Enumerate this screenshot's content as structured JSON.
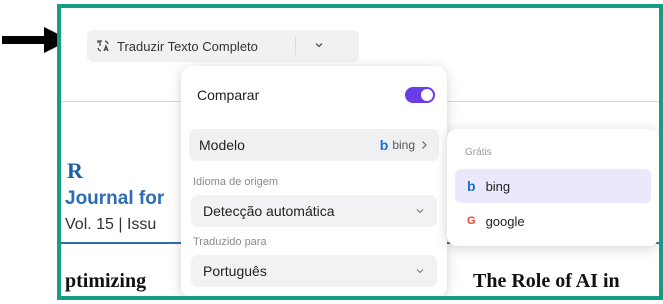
{
  "toolbar": {
    "translate_label": "Traduzir Texto Completo",
    "translate_icon": "translate-icon",
    "dropdown_icon": "chevron-down-icon"
  },
  "document": {
    "heading_r": "R",
    "journal": "Journal for",
    "volume": "Vol. 15 | Issu",
    "title_left": "ptimizing",
    "title_right": "The Role of AI in"
  },
  "popup": {
    "compare_label": "Comparar",
    "compare_enabled": true,
    "model_label": "Modelo",
    "model_logo": "b",
    "model_value": "bing",
    "source_label": "Idioma de origem",
    "source_value": "Detecção automática",
    "target_label": "Traduzido para",
    "target_value": "Português"
  },
  "engines": {
    "header": "Grátis",
    "items": [
      {
        "logo": "b",
        "name": "bing",
        "selected": true
      },
      {
        "logo": "G",
        "name": "google",
        "selected": false
      }
    ]
  },
  "colors": {
    "frame": "#169c82",
    "toggle": "#6a3de8",
    "bing": "#1b6fd8",
    "accent_selected": "#ece8fb",
    "arrow": "#000000"
  }
}
